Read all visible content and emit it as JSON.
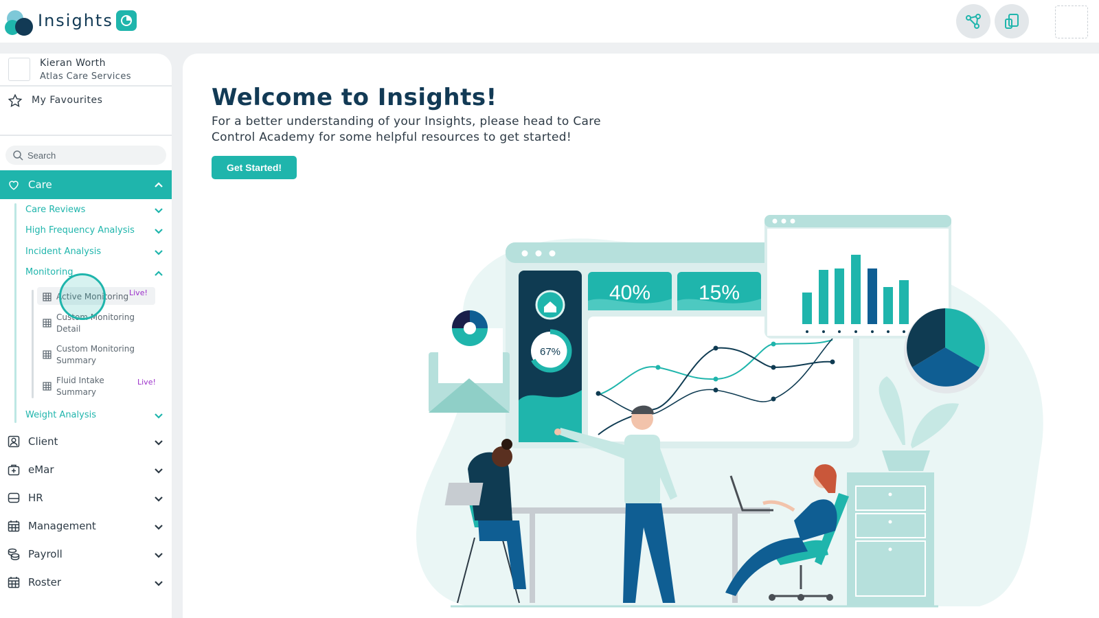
{
  "app": {
    "brand": "Insights"
  },
  "user": {
    "name": "Kieran Worth",
    "organisation": "Atlas Care Services"
  },
  "favourites": {
    "label": "My Favourites"
  },
  "search": {
    "placeholder": "Search"
  },
  "nav": {
    "care": {
      "label": "Care",
      "expanded": true,
      "items": [
        {
          "label": "Care Reviews"
        },
        {
          "label": "High Frequency Analysis"
        },
        {
          "label": "Incident Analysis"
        },
        {
          "label": "Monitoring",
          "expanded": true
        },
        {
          "label": "Weight Analysis"
        }
      ],
      "monitoring_items": [
        {
          "label": "Active Monitoring",
          "badge": "Live!"
        },
        {
          "label": "Custom Monitoring Detail",
          "badge": ""
        },
        {
          "label": "Custom Monitoring Summary",
          "badge": ""
        },
        {
          "label": "Fluid Intake Summary",
          "badge": "Live!"
        }
      ]
    },
    "modules": [
      {
        "label": "Client",
        "icon": "client-icon"
      },
      {
        "label": "eMar",
        "icon": "medical-case-icon"
      },
      {
        "label": "HR",
        "icon": "hr-icon"
      },
      {
        "label": "Management",
        "icon": "calendar-grid-icon"
      },
      {
        "label": "Payroll",
        "icon": "coins-icon"
      },
      {
        "label": "Roster",
        "icon": "calendar-icon"
      }
    ]
  },
  "main": {
    "title": "Welcome to Insights!",
    "intro": "For a better understanding of your Insights, please head to Care Control Academy for some helpful resources to get started!",
    "cta_label": "Get Started!"
  },
  "illustration": {
    "stat_1": "40%",
    "stat_2": "15%",
    "ring_value": "67%"
  },
  "colors": {
    "accent": "#1fb5ac",
    "navy": "#123a55",
    "live_badge": "#9b2fc9"
  }
}
